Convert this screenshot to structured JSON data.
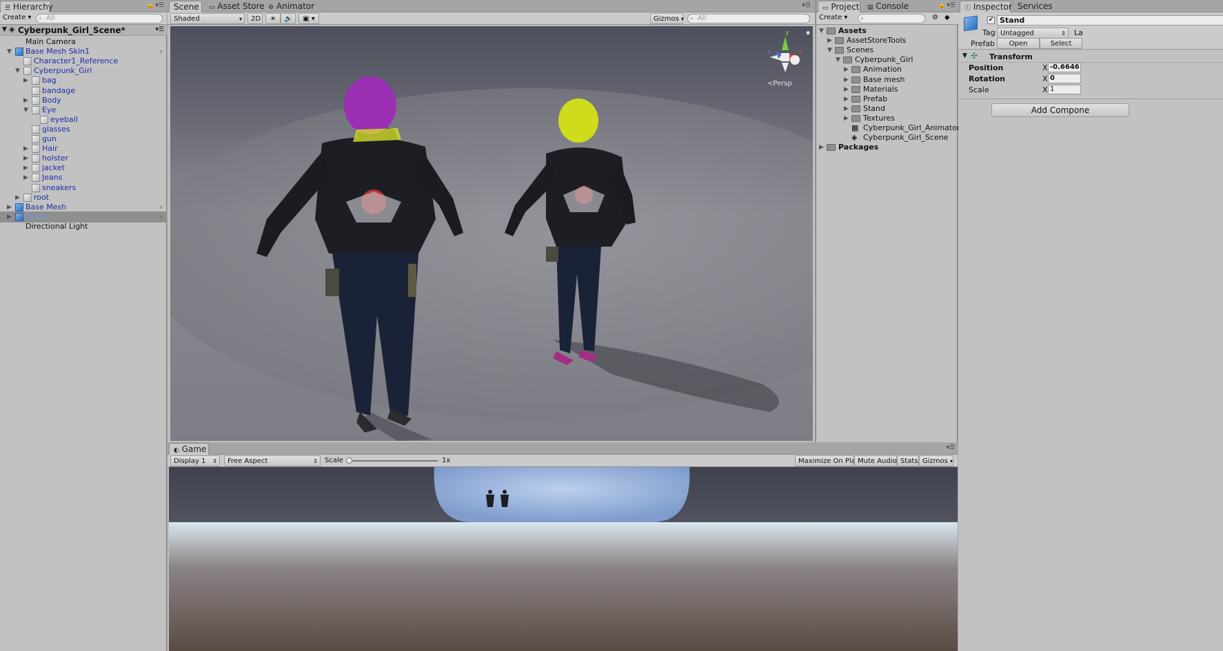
{
  "hierarchy": {
    "tab": "Hierarchy",
    "create_label": "Create ▾",
    "search_placeholder": "All",
    "scene_name": "Cyberpunk_Girl_Scene*",
    "items": [
      {
        "label": "Main Camera",
        "depth": 1,
        "color": "black",
        "arrow": "",
        "icon": "none"
      },
      {
        "label": "Base Mesh Skin1",
        "depth": 1,
        "color": "blue",
        "arrow": "▼",
        "icon": "prefab",
        "more": true
      },
      {
        "label": "Character1_Reference",
        "depth": 2,
        "color": "blue",
        "arrow": "",
        "icon": "gameobject"
      },
      {
        "label": "Cyberpunk_Girl",
        "depth": 2,
        "color": "blue",
        "arrow": "▼",
        "icon": "gameobject"
      },
      {
        "label": "bag",
        "depth": 3,
        "color": "blue",
        "arrow": "▶",
        "icon": "gameobject"
      },
      {
        "label": "bandage",
        "depth": 3,
        "color": "blue",
        "arrow": "",
        "icon": "gameobject"
      },
      {
        "label": "Body",
        "depth": 3,
        "color": "blue",
        "arrow": "▶",
        "icon": "gameobject"
      },
      {
        "label": "Eye",
        "depth": 3,
        "color": "blue",
        "arrow": "▼",
        "icon": "gameobject"
      },
      {
        "label": "eyeball",
        "depth": 4,
        "color": "blue",
        "arrow": "",
        "icon": "gameobject"
      },
      {
        "label": "glasses",
        "depth": 3,
        "color": "blue",
        "arrow": "",
        "icon": "gameobject"
      },
      {
        "label": "gun",
        "depth": 3,
        "color": "blue",
        "arrow": "",
        "icon": "gameobject"
      },
      {
        "label": "Hair",
        "depth": 3,
        "color": "blue",
        "arrow": "▶",
        "icon": "gameobject"
      },
      {
        "label": "holster",
        "depth": 3,
        "color": "blue",
        "arrow": "▶",
        "icon": "gameobject"
      },
      {
        "label": "jacket",
        "depth": 3,
        "color": "blue",
        "arrow": "▶",
        "icon": "gameobject"
      },
      {
        "label": "Jeans",
        "depth": 3,
        "color": "blue",
        "arrow": "▶",
        "icon": "gameobject"
      },
      {
        "label": "sneakers",
        "depth": 3,
        "color": "blue",
        "arrow": "",
        "icon": "gameobject"
      },
      {
        "label": "root",
        "depth": 2,
        "color": "blue",
        "arrow": "▶",
        "icon": "gameobject"
      },
      {
        "label": "Base Mesh",
        "depth": 1,
        "color": "blue",
        "arrow": "▶",
        "icon": "prefab",
        "more": true
      },
      {
        "label": "Stand",
        "depth": 1,
        "color": "blue",
        "arrow": "▶",
        "icon": "prefab",
        "more": true,
        "selected": true
      },
      {
        "label": "Directional Light",
        "depth": 1,
        "color": "black",
        "arrow": "",
        "icon": "none"
      }
    ]
  },
  "scene": {
    "tabs": [
      "Scene",
      "Asset Store",
      "Animator"
    ],
    "shading_mode": "Shaded",
    "mode_2d": "2D",
    "gizmos_label": "Gizmos",
    "search_placeholder": "All",
    "persp_label": "Persp",
    "axis_labels": {
      "y": "y",
      "x": "x",
      "z": "z"
    }
  },
  "game": {
    "tab": "Game",
    "display": "Display 1",
    "aspect": "Free Aspect",
    "scale_label": "Scale",
    "scale_value": "1x",
    "maximize": "Maximize On Play",
    "mute": "Mute Audio",
    "stats": "Stats",
    "gizmos": "Gizmos"
  },
  "project": {
    "tabs": [
      "Project",
      "Console"
    ],
    "create_label": "Create ▾",
    "items": [
      {
        "label": "Assets",
        "depth": 0,
        "arrow": "▼",
        "icon": "folder",
        "bold": true
      },
      {
        "label": "AssetStoreTools",
        "depth": 1,
        "arrow": "▶",
        "icon": "folder"
      },
      {
        "label": "Scenes",
        "depth": 1,
        "arrow": "▼",
        "icon": "folder"
      },
      {
        "label": "Cyberpunk_Girl",
        "depth": 2,
        "arrow": "▼",
        "icon": "folder"
      },
      {
        "label": "Animation",
        "depth": 3,
        "arrow": "▶",
        "icon": "folder"
      },
      {
        "label": "Base mesh",
        "depth": 3,
        "arrow": "▶",
        "icon": "folder"
      },
      {
        "label": "Materials",
        "depth": 3,
        "arrow": "▶",
        "icon": "folder"
      },
      {
        "label": "Prefab",
        "depth": 3,
        "arrow": "▶",
        "icon": "folder"
      },
      {
        "label": "Stand",
        "depth": 3,
        "arrow": "▶",
        "icon": "folder"
      },
      {
        "label": "Textures",
        "depth": 3,
        "arrow": "▶",
        "icon": "folder"
      },
      {
        "label": "Cyberpunk_Girl_Animator_",
        "depth": 3,
        "arrow": "",
        "icon": "animator"
      },
      {
        "label": "Cyberpunk_Girl_Scene",
        "depth": 3,
        "arrow": "",
        "icon": "unity"
      },
      {
        "label": "Packages",
        "depth": 0,
        "arrow": "▶",
        "icon": "folder",
        "bold": true
      }
    ]
  },
  "inspector": {
    "tabs": [
      "Inspector",
      "Services"
    ],
    "object_name": "Stand",
    "tag_label": "Tag",
    "tag_value": "Untagged",
    "layer_label": "La",
    "prefab_label": "Prefab",
    "open_label": "Open",
    "select_label": "Select",
    "transform_label": "Transform",
    "position_label": "Position",
    "rotation_label": "Rotation",
    "scale_label": "Scale",
    "x_label": "X",
    "position_x": "-0.6646",
    "rotation_x": "0",
    "scale_x": "1",
    "add_component": "Add Compone"
  }
}
